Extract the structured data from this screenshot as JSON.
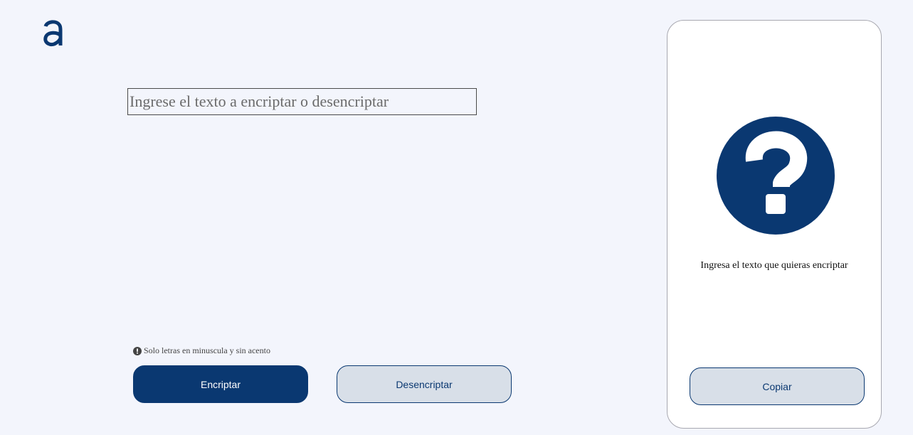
{
  "logo": {
    "icon": "alura-logo-icon",
    "color": "#0a3871"
  },
  "input": {
    "placeholder": "Ingrese el texto a encriptar o desencriptar"
  },
  "hint": {
    "icon": "info-icon",
    "text": "Solo letras en minuscula y sin acento"
  },
  "buttons": {
    "encrypt": "Encriptar",
    "decrypt": "Desencriptar",
    "copy": "Copiar"
  },
  "output_panel": {
    "icon": "question-mark-icon",
    "message": "Ingresa el texto que quieras encriptar"
  },
  "colors": {
    "background": "#f3f5fc",
    "primary": "#0a3871",
    "secondary_button": "#d8dfe8",
    "panel": "#ffffff"
  }
}
